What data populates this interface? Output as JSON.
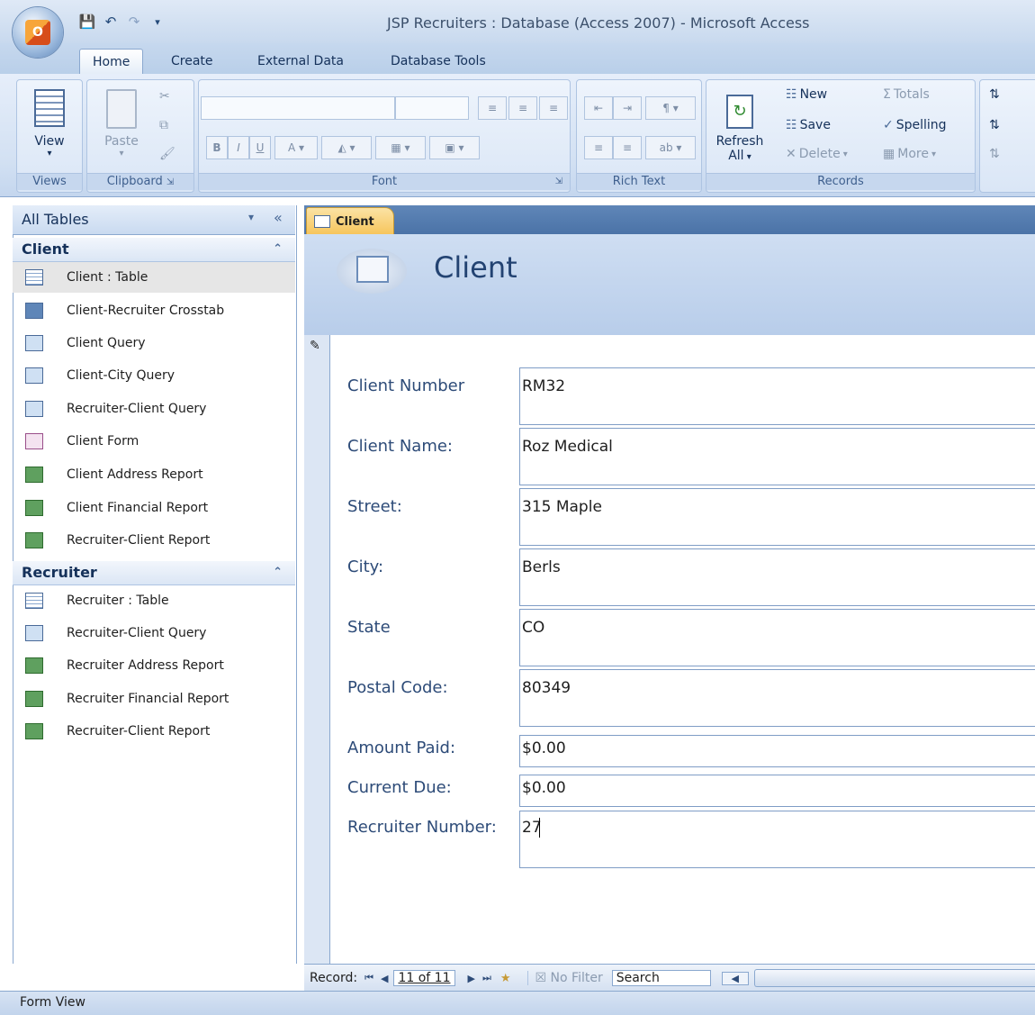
{
  "window": {
    "title": "JSP Recruiters : Database (Access 2007) - Microsoft Access"
  },
  "ribbon_tabs": [
    "Home",
    "Create",
    "External Data",
    "Database Tools"
  ],
  "ribbon": {
    "views": {
      "label": "Views",
      "view_btn": "View"
    },
    "clipboard": {
      "label": "Clipboard",
      "paste_btn": "Paste"
    },
    "font": {
      "label": "Font"
    },
    "rich_text": {
      "label": "Rich Text"
    },
    "records": {
      "label": "Records",
      "refresh_btn": "Refresh",
      "refresh_sub": "All",
      "new_btn": "New",
      "save_btn": "Save",
      "delete_btn": "Delete",
      "totals_btn": "Totals",
      "spelling_btn": "Spelling",
      "more_btn": "More"
    }
  },
  "nav": {
    "header": "All Tables",
    "sections": [
      {
        "title": "Client",
        "items": [
          "Client : Table",
          "Client-Recruiter Crosstab",
          "Client Query",
          "Client-City Query",
          "Recruiter-Client Query",
          "Client Form",
          "Client Address Report",
          "Client Financial Report",
          "Recruiter-Client Report"
        ]
      },
      {
        "title": "Recruiter",
        "items": [
          "Recruiter : Table",
          "Recruiter-Client Query",
          "Recruiter Address Report",
          "Recruiter Financial Report",
          "Recruiter-Client Report"
        ]
      }
    ]
  },
  "doc": {
    "tab_label": "Client",
    "form_title": "Client"
  },
  "form_fields": [
    {
      "label": "Client Number",
      "value": "RM32"
    },
    {
      "label": "Client Name:",
      "value": "Roz Medical"
    },
    {
      "label": "Street:",
      "value": "315 Maple"
    },
    {
      "label": "City:",
      "value": "Berls"
    },
    {
      "label": "State",
      "value": "CO"
    },
    {
      "label": "Postal Code:",
      "value": "80349"
    },
    {
      "label": "Amount Paid:",
      "value": "$0.00"
    },
    {
      "label": "Current Due:",
      "value": "$0.00"
    },
    {
      "label": "Recruiter Number:",
      "value": "27"
    }
  ],
  "record_nav": {
    "label": "Record:",
    "position": "11 of 11",
    "filter": "No Filter",
    "search": "Search"
  },
  "status": {
    "text": "Form View"
  },
  "colors": {
    "ribbon": "#d3e1f3",
    "accent": "#4b73a7",
    "doc_tab": "#f6c45a"
  }
}
